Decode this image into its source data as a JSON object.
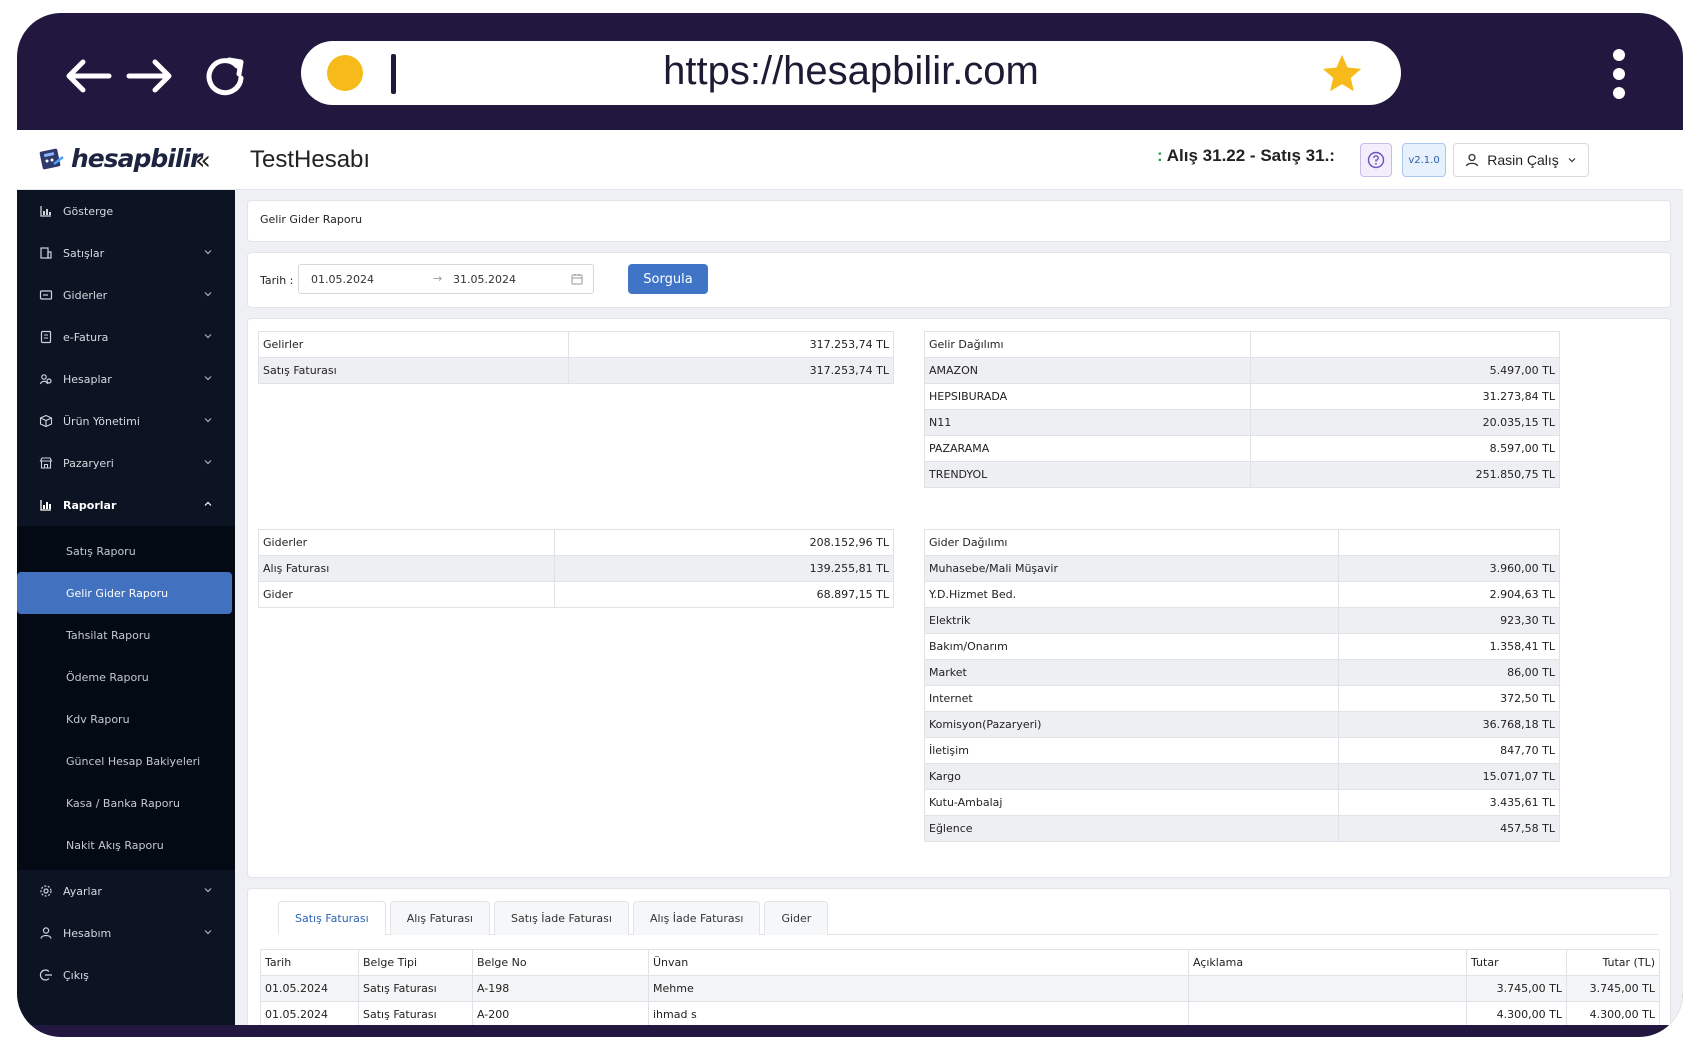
{
  "browser": {
    "url": "https://hesapbilir.com",
    "back_icon": "back-arrow-icon",
    "forward_icon": "forward-arrow-icon",
    "reload_icon": "reload-icon",
    "star_color": "#f6bb1a",
    "frame_color": "#22173f"
  },
  "topbar": {
    "logo_text": "hesapbilir",
    "collapse_label": "«",
    "account_name": "TestHesabı",
    "ticker_prefix": ":",
    "ticker_text": "Alış 31.22 - Satış 31.:",
    "version": "v2.1.0",
    "user_name": "Rasin Çalış"
  },
  "sidebar": {
    "items": [
      {
        "label": "Gösterge",
        "icon": "chart-icon"
      },
      {
        "label": "Satışlar",
        "icon": "sales-icon"
      },
      {
        "label": "Giderler",
        "icon": "expense-icon"
      },
      {
        "label": "e-Fatura",
        "icon": "invoice-icon"
      },
      {
        "label": "Hesaplar",
        "icon": "accounts-icon"
      },
      {
        "label": "Ürün Yönetimi",
        "icon": "box-icon"
      },
      {
        "label": "Pazaryeri",
        "icon": "store-icon"
      },
      {
        "label": "Raporlar",
        "icon": "report-icon"
      },
      {
        "label": "Ayarlar",
        "icon": "gear-icon"
      },
      {
        "label": "Hesabım",
        "icon": "user-icon"
      },
      {
        "label": "Çıkış",
        "icon": "logout-icon"
      }
    ],
    "reports_sub": [
      "Satış Raporu",
      "Gelir Gider Raporu",
      "Tahsilat Raporu",
      "Ödeme Raporu",
      "Kdv Raporu",
      "Güncel Hesap Bakiyeleri",
      "Kasa / Banka Raporu",
      "Nakit Akış Raporu"
    ],
    "active_color": "#4272bf"
  },
  "page": {
    "breadcrumb": "Gelir Gider Raporu",
    "filter_label": "Tarih :",
    "date_start": "01.05.2024",
    "date_arrow": "→",
    "date_end": "31.05.2024",
    "query_button": "Sorgula"
  },
  "income": {
    "rows": [
      [
        "Gelirler",
        "317.253,74 TL"
      ],
      [
        "Satış Faturası",
        "317.253,74 TL"
      ]
    ]
  },
  "income_dist": {
    "rows": [
      [
        "Gelir Dağılımı",
        ""
      ],
      [
        "AMAZON",
        "5.497,00 TL"
      ],
      [
        "HEPSIBURADA",
        "31.273,84 TL"
      ],
      [
        "N11",
        "20.035,15 TL"
      ],
      [
        "PAZARAMA",
        "8.597,00 TL"
      ],
      [
        "TRENDYOL",
        "251.850,75 TL"
      ]
    ]
  },
  "expenses": {
    "rows": [
      [
        "Giderler",
        "208.152,96 TL"
      ],
      [
        "Alış Faturası",
        "139.255,81 TL"
      ],
      [
        "Gider",
        "68.897,15 TL"
      ]
    ]
  },
  "expense_dist": {
    "rows": [
      [
        "Gider Dağılımı",
        ""
      ],
      [
        "Muhasebe/Mali Müşavir",
        "3.960,00 TL"
      ],
      [
        "Y.D.Hizmet Bed.",
        "2.904,63 TL"
      ],
      [
        "Elektrik",
        "923,30 TL"
      ],
      [
        "Bakım/Onarım",
        "1.358,41 TL"
      ],
      [
        "Market",
        "86,00 TL"
      ],
      [
        "Internet",
        "372,50 TL"
      ],
      [
        "Komisyon(Pazaryeri)",
        "36.768,18 TL"
      ],
      [
        "İletişim",
        "847,70 TL"
      ],
      [
        "Kargo",
        "15.071,07 TL"
      ],
      [
        "Kutu-Ambalaj",
        "3.435,61 TL"
      ],
      [
        "Eğlence",
        "457,58 TL"
      ]
    ]
  },
  "tabs": [
    "Satış Faturası",
    "Alış Faturası",
    "Satış İade Faturası",
    "Alış İade Faturası",
    "Gider"
  ],
  "detail": {
    "headers": [
      "Tarih",
      "Belge Tipi",
      "Belge No",
      "Ünvan",
      "Açıklama",
      "Tutar",
      "Tutar (TL)"
    ],
    "rows": [
      [
        "01.05.2024",
        "Satış Faturası",
        "A-198",
        "Mehme",
        "",
        "3.745,00 TL",
        "3.745,00 TL"
      ],
      [
        "01.05.2024",
        "Satış Faturası",
        "A-200",
        "ihmad s",
        "",
        "4.300,00 TL",
        "4.300,00 TL"
      ]
    ]
  }
}
